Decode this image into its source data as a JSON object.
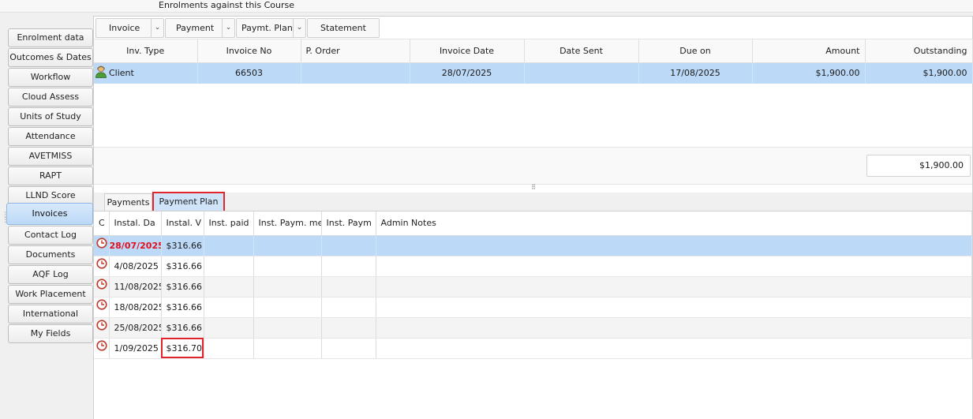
{
  "header": {
    "title": "Enrolments against this Course"
  },
  "sidebar": {
    "items": [
      {
        "label": "Enrolment data"
      },
      {
        "label": "Outcomes & Dates"
      },
      {
        "label": "Workflow"
      },
      {
        "label": "Cloud Assess"
      },
      {
        "label": "Units of Study"
      },
      {
        "label": "Attendance"
      },
      {
        "label": "AVETMISS"
      },
      {
        "label": "RAPT"
      },
      {
        "label": "LLND Score"
      },
      {
        "label": "Invoices",
        "active": true
      },
      {
        "label": "Contact Log"
      },
      {
        "label": "Documents"
      },
      {
        "label": "AQF Log"
      },
      {
        "label": "Work Placement"
      },
      {
        "label": "International"
      },
      {
        "label": "My Fields"
      }
    ]
  },
  "toolbar": {
    "invoice": "Invoice",
    "payment": "Payment",
    "payment_plan": "Paymt. Plan",
    "statement": "Statement"
  },
  "invoices": {
    "columns": [
      "Inv. Type",
      "Invoice No",
      "P. Order",
      "Invoice Date",
      "Date Sent",
      "Due on",
      "Amount",
      "Outstanding"
    ],
    "rows": [
      {
        "type": "Client",
        "invoice_no": "66503",
        "p_order": "",
        "invoice_date": "28/07/2025",
        "date_sent": "",
        "due_on": "17/08/2025",
        "amount": "$1,900.00",
        "outstanding": "$1,900.00"
      }
    ],
    "total": "$1,900.00"
  },
  "tabs": [
    {
      "label": "Payments"
    },
    {
      "label": "Payment Plan",
      "active": true
    }
  ],
  "plan": {
    "columns": [
      "C",
      "Instal. Da",
      "Instal. V",
      "Inst. paid",
      "Inst. Paym. me",
      "Inst. Paym",
      "Admin Notes"
    ],
    "rows": [
      {
        "date": "28/07/2025",
        "value": "$316.66",
        "overdue": true
      },
      {
        "date": "4/08/2025",
        "value": "$316.66"
      },
      {
        "date": "11/08/2025",
        "value": "$316.66"
      },
      {
        "date": "18/08/2025",
        "value": "$316.66"
      },
      {
        "date": "25/08/2025",
        "value": "$316.66"
      },
      {
        "date": "1/09/2025",
        "value": "$316.70"
      }
    ]
  },
  "colors": {
    "selection": "#bcd9f7",
    "highlight": "#e0262b",
    "overdue_text": "#e0101c",
    "clock": "#c0392b"
  },
  "icons": {
    "person": "person-icon",
    "clock": "clock-icon",
    "dropdown": "chevron-down-icon"
  }
}
